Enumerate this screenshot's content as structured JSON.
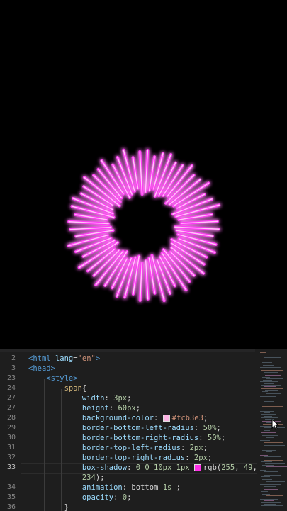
{
  "colors": {
    "background": "#000000",
    "glow": "#ff3df5",
    "core": "#ffc6f7",
    "swatch": "#fcb3e3",
    "shadow_swatch": "#ff31e7"
  },
  "animation": {
    "ray_count": 60,
    "description_icons": [
      "burst-graphic"
    ]
  },
  "editor": {
    "lines": [
      {
        "num": "2",
        "segs": [
          {
            "t": "<html ",
            "c": "tag"
          },
          {
            "t": "lang",
            "c": "attr"
          },
          {
            "t": "=",
            "c": "plain"
          },
          {
            "t": "\"en\"",
            "c": "str"
          },
          {
            "t": ">",
            "c": "tag"
          }
        ]
      },
      {
        "num": "3",
        "segs": [
          {
            "t": "<head>",
            "c": "tag"
          }
        ]
      },
      {
        "num": "23",
        "segs": [
          {
            "t": "    <style>",
            "c": "tag"
          }
        ]
      },
      {
        "num": "24",
        "segs": [
          {
            "t": "        span",
            "c": "sel"
          },
          {
            "t": "{",
            "c": "plain"
          }
        ]
      },
      {
        "num": "27",
        "segs": [
          {
            "t": "            width",
            "c": "prop"
          },
          {
            "t": ": ",
            "c": "plain"
          },
          {
            "t": "3px",
            "c": "val"
          },
          {
            "t": ";",
            "c": "plain"
          }
        ]
      },
      {
        "num": "27",
        "segs": [
          {
            "t": "            height",
            "c": "prop"
          },
          {
            "t": ": ",
            "c": "plain"
          },
          {
            "t": "60px",
            "c": "val"
          },
          {
            "t": ";",
            "c": "plain"
          }
        ]
      },
      {
        "num": "28",
        "segs": [
          {
            "t": "            background-color",
            "c": "prop"
          },
          {
            "t": ": ",
            "c": "plain"
          },
          {
            "swatch": "#fcb3e3"
          },
          {
            "t": "#fcb3e3",
            "c": "kw"
          },
          {
            "t": ";",
            "c": "plain"
          }
        ]
      },
      {
        "num": "29",
        "segs": [
          {
            "t": "            border-bottom-left-radius",
            "c": "prop"
          },
          {
            "t": ": ",
            "c": "plain"
          },
          {
            "t": "50%",
            "c": "val"
          },
          {
            "t": ";",
            "c": "plain"
          }
        ]
      },
      {
        "num": "30",
        "segs": [
          {
            "t": "            border-bottom-right-radius",
            "c": "prop"
          },
          {
            "t": ": ",
            "c": "plain"
          },
          {
            "t": "50%",
            "c": "val"
          },
          {
            "t": ";",
            "c": "plain"
          }
        ]
      },
      {
        "num": "31",
        "segs": [
          {
            "t": "            border-top-left-radius",
            "c": "prop"
          },
          {
            "t": ": ",
            "c": "plain"
          },
          {
            "t": "2px",
            "c": "val"
          },
          {
            "t": ";",
            "c": "plain"
          }
        ]
      },
      {
        "num": "32",
        "segs": [
          {
            "t": "            border-top-right-radius",
            "c": "prop"
          },
          {
            "t": ": ",
            "c": "plain"
          },
          {
            "t": "2px",
            "c": "val"
          },
          {
            "t": ";",
            "c": "plain"
          }
        ]
      },
      {
        "num": "33",
        "segs": [
          {
            "t": "            box-shadow",
            "c": "prop"
          },
          {
            "t": ": ",
            "c": "plain"
          },
          {
            "t": "0 0 10px 1px ",
            "c": "val"
          },
          {
            "swatch": "#ff31e7"
          },
          {
            "t": "rgb",
            "c": "plain"
          },
          {
            "t": "(",
            "c": "plain"
          },
          {
            "t": "255",
            "c": "val"
          },
          {
            "t": ", ",
            "c": "plain"
          },
          {
            "t": "49",
            "c": "val"
          },
          {
            "t": ",",
            "c": "plain"
          }
        ]
      },
      {
        "num": "",
        "segs": [
          {
            "t": "            234",
            "c": "val"
          },
          {
            "t": ");",
            "c": "plain"
          }
        ]
      },
      {
        "num": "34",
        "segs": [
          {
            "t": "            animation",
            "c": "prop"
          },
          {
            "t": ": ",
            "c": "plain"
          },
          {
            "t": "bottom ",
            "c": "plain"
          },
          {
            "t": "1s",
            "c": "val"
          },
          {
            "t": " ;",
            "c": "plain"
          }
        ]
      },
      {
        "num": "35",
        "segs": [
          {
            "t": "            opacity",
            "c": "prop"
          },
          {
            "t": ": ",
            "c": "plain"
          },
          {
            "t": "0",
            "c": "val"
          },
          {
            "t": ";",
            "c": "plain"
          }
        ]
      },
      {
        "num": "36",
        "segs": [
          {
            "t": "        }",
            "c": "plain"
          }
        ]
      }
    ],
    "active_line": "33"
  }
}
